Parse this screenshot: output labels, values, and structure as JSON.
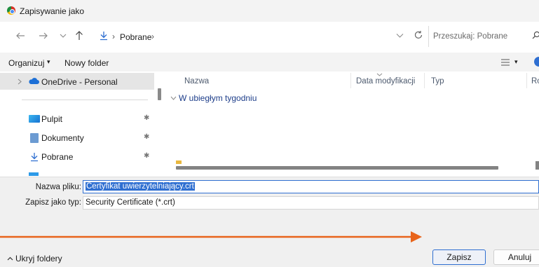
{
  "window": {
    "title": "Zapisywanie jako"
  },
  "nav": {
    "breadcrumb_sep": "›",
    "path": "Pobrane",
    "search_placeholder": "Przeszukaj: Pobrane"
  },
  "toolbar": {
    "organize": "Organizuj",
    "organize_arrow": "▾",
    "new_folder": "Nowy folder",
    "view_arrow": "▾"
  },
  "sidebar": {
    "items": [
      {
        "label": "OneDrive - Personal",
        "icon": "cloud-icon"
      },
      {
        "label": "Pulpit",
        "icon": "desktop-icon"
      },
      {
        "label": "Dokumenty",
        "icon": "documents-icon"
      },
      {
        "label": "Pobrane",
        "icon": "download-icon"
      }
    ]
  },
  "content": {
    "columns": [
      "Nazwa",
      "Data modyfikacji",
      "Typ",
      "Ro"
    ],
    "group_label": "W ubiegłym tygodniu"
  },
  "form": {
    "filename_label": "Nazwa pliku:",
    "filename_value": "Certyfikat uwierzytelniający.crt",
    "filetype_label": "Zapisz jako typ:",
    "filetype_value": "Security Certificate (*.crt)"
  },
  "footer": {
    "hide_folders": "Ukryj foldery",
    "save": "Zapisz",
    "cancel": "Anuluj"
  },
  "colors": {
    "accent": "#2f6fd1",
    "annotation_arrow": "#e8641b"
  }
}
